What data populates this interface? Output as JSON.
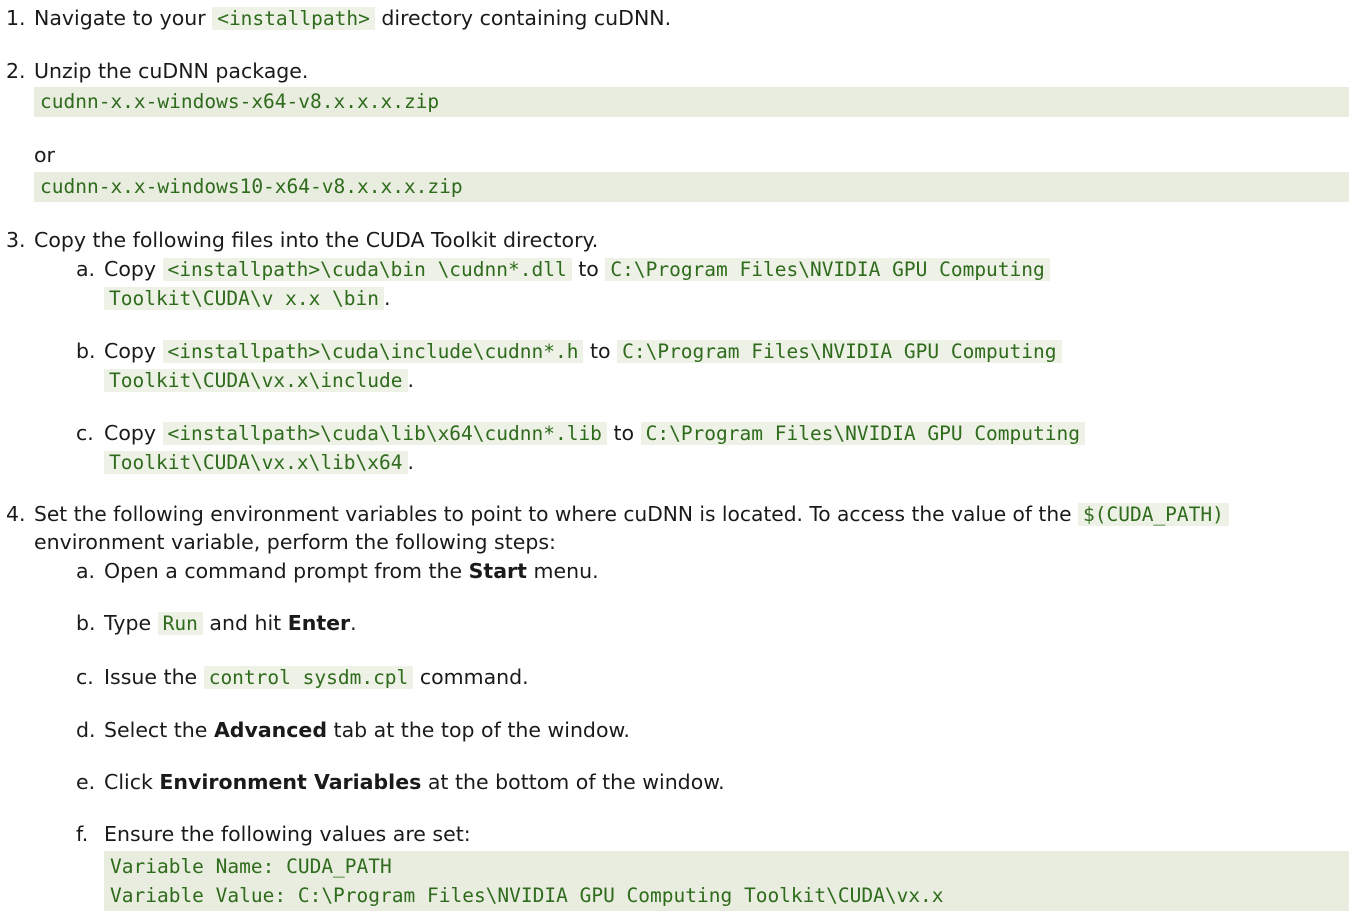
{
  "steps": {
    "s1": {
      "num": "1.",
      "pre": "Navigate to your",
      "code": "<installpath>",
      "post": "directory containing cuDNN."
    },
    "s2": {
      "num": "2.",
      "text": "Unzip the cuDNN package.",
      "code1": "cudnn-x.x-windows-x64-v8.x.x.x.zip",
      "or": "or",
      "code2": "cudnn-x.x-windows10-x64-v8.x.x.x.zip"
    },
    "s3": {
      "num": "3.",
      "text": "Copy the following files into the CUDA Toolkit directory.",
      "a": {
        "num": "a.",
        "copy": "Copy",
        "src": "<installpath>\\cuda\\bin \\cudnn*.dll",
        "to": "to",
        "dst1": "C:\\Program Files\\NVIDIA GPU Computing",
        "dst2": "Toolkit\\CUDA\\v x.x \\bin",
        "end": "."
      },
      "b": {
        "num": "b.",
        "copy": "Copy",
        "src": "<installpath>\\cuda\\include\\cudnn*.h",
        "to": "to",
        "dst1": "C:\\Program Files\\NVIDIA GPU Computing",
        "dst2": "Toolkit\\CUDA\\vx.x\\include",
        "end": "."
      },
      "c": {
        "num": "c.",
        "copy": "Copy",
        "src": "<installpath>\\cuda\\lib\\x64\\cudnn*.lib",
        "to": "to",
        "dst1": "C:\\Program Files\\NVIDIA GPU Computing",
        "dst2": "Toolkit\\CUDA\\vx.x\\lib\\x64",
        "end": "."
      }
    },
    "s4": {
      "num": "4.",
      "pre": "Set the following environment variables to point to where cuDNN is located. To access the value of the",
      "code": "$(CUDA_PATH)",
      "line2": "environment variable, perform the following steps:",
      "a": {
        "num": "a.",
        "pre": "Open a command prompt from the",
        "bold": "Start",
        "post": "menu."
      },
      "b": {
        "num": "b.",
        "pre": "Type",
        "code": "Run",
        "mid": "and hit",
        "bold": "Enter",
        "post": "."
      },
      "c": {
        "num": "c.",
        "pre": "Issue the",
        "code": "control sysdm.cpl",
        "post": "command."
      },
      "d": {
        "num": "d.",
        "pre": "Select the",
        "bold": "Advanced",
        "post": "tab at the top of the window."
      },
      "e": {
        "num": "e.",
        "pre": "Click",
        "bold": "Environment Variables",
        "post": "at the bottom of the window."
      },
      "f": {
        "num": "f.",
        "text": "Ensure the following values are set:",
        "code1": "Variable Name: CUDA_PATH",
        "code2": "Variable Value: C:\\Program Files\\NVIDIA GPU Computing Toolkit\\CUDA\\vx.x"
      }
    }
  }
}
